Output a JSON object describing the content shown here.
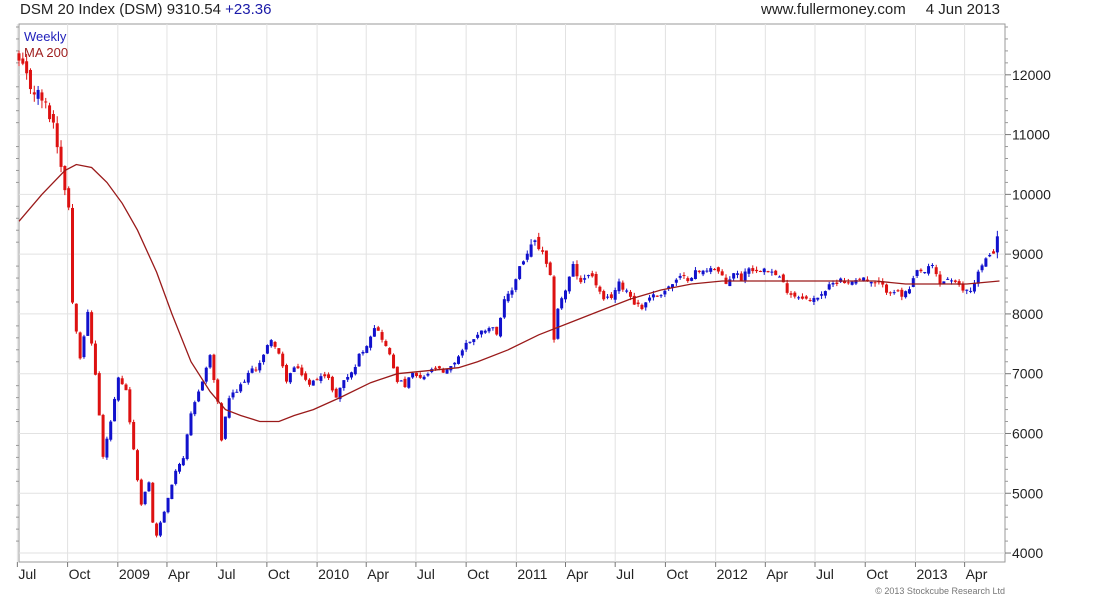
{
  "header": {
    "title": "DSM 20 Index (DSM)",
    "last": "9310.54",
    "change": "+23.36",
    "site": "www.fullermoney.com",
    "date": "4 Jun 2013"
  },
  "legend": {
    "weekly": "Weekly",
    "ma": "MA 200"
  },
  "copyright": "© 2013 Stockcube Research Ltd",
  "colors": {
    "up": "#1111cc",
    "down": "#dd1111",
    "ma": "#9a1a1a",
    "grid": "#e2e2e2"
  },
  "chart_data": {
    "type": "candlestick",
    "frequency": "weekly",
    "ylim": [
      3850,
      12850
    ],
    "yticks": [
      4000,
      5000,
      6000,
      7000,
      8000,
      9000,
      10000,
      11000,
      12000
    ],
    "x_range": [
      "2008-07-04",
      "2013-06-14"
    ],
    "xticks": [
      {
        "label": "Jul",
        "date": "2008-07-01"
      },
      {
        "label": "Oct",
        "date": "2008-10-01"
      },
      {
        "label": "2009",
        "date": "2009-01-01"
      },
      {
        "label": "Apr",
        "date": "2009-04-01"
      },
      {
        "label": "Jul",
        "date": "2009-07-01"
      },
      {
        "label": "Oct",
        "date": "2009-10-01"
      },
      {
        "label": "2010",
        "date": "2010-01-01"
      },
      {
        "label": "Apr",
        "date": "2010-04-01"
      },
      {
        "label": "Jul",
        "date": "2010-07-01"
      },
      {
        "label": "Oct",
        "date": "2010-10-01"
      },
      {
        "label": "2011",
        "date": "2011-01-01"
      },
      {
        "label": "Apr",
        "date": "2011-04-01"
      },
      {
        "label": "Jul",
        "date": "2011-07-01"
      },
      {
        "label": "Oct",
        "date": "2011-10-01"
      },
      {
        "label": "2012",
        "date": "2012-01-01"
      },
      {
        "label": "Apr",
        "date": "2012-04-01"
      },
      {
        "label": "Jul",
        "date": "2012-07-01"
      },
      {
        "label": "Oct",
        "date": "2012-10-01"
      },
      {
        "label": "2013",
        "date": "2013-01-01"
      },
      {
        "label": "Apr",
        "date": "2013-04-01"
      }
    ],
    "close_series": [
      [
        "2008-07-04",
        12200
      ],
      [
        "2008-07-25",
        11800
      ],
      [
        "2008-08-15",
        11600
      ],
      [
        "2008-09-05",
        11200
      ],
      [
        "2008-09-19",
        10500
      ],
      [
        "2008-10-03",
        9800
      ],
      [
        "2008-10-10",
        8200
      ],
      [
        "2008-10-24",
        7300
      ],
      [
        "2008-11-07",
        8000
      ],
      [
        "2008-11-21",
        7000
      ],
      [
        "2008-12-05",
        5600
      ],
      [
        "2008-12-19",
        6200
      ],
      [
        "2009-01-02",
        6900
      ],
      [
        "2009-01-16",
        6700
      ],
      [
        "2009-01-30",
        5700
      ],
      [
        "2009-02-13",
        4800
      ],
      [
        "2009-02-27",
        5200
      ],
      [
        "2009-03-06",
        4500
      ],
      [
        "2009-03-13",
        4300
      ],
      [
        "2009-03-20",
        4500
      ],
      [
        "2009-04-03",
        4900
      ],
      [
        "2009-04-17",
        5400
      ],
      [
        "2009-05-01",
        5600
      ],
      [
        "2009-05-15",
        6300
      ],
      [
        "2009-06-05",
        6900
      ],
      [
        "2009-06-19",
        7300
      ],
      [
        "2009-07-03",
        6500
      ],
      [
        "2009-07-10",
        5900
      ],
      [
        "2009-07-24",
        6600
      ],
      [
        "2009-08-07",
        6700
      ],
      [
        "2009-08-28",
        7000
      ],
      [
        "2009-09-11",
        7100
      ],
      [
        "2009-09-25",
        7300
      ],
      [
        "2009-10-09",
        7600
      ],
      [
        "2009-10-23",
        7300
      ],
      [
        "2009-11-06",
        6900
      ],
      [
        "2009-11-20",
        7100
      ],
      [
        "2009-12-04",
        7000
      ],
      [
        "2009-12-18",
        6800
      ],
      [
        "2010-01-08",
        7000
      ],
      [
        "2010-01-22",
        6900
      ],
      [
        "2010-02-05",
        6600
      ],
      [
        "2010-02-19",
        6900
      ],
      [
        "2010-03-05",
        7000
      ],
      [
        "2010-03-19",
        7300
      ],
      [
        "2010-04-02",
        7500
      ],
      [
        "2010-04-16",
        7800
      ],
      [
        "2010-04-30",
        7600
      ],
      [
        "2010-05-14",
        7300
      ],
      [
        "2010-05-28",
        6900
      ],
      [
        "2010-06-11",
        6800
      ],
      [
        "2010-06-25",
        7000
      ],
      [
        "2010-07-09",
        6900
      ],
      [
        "2010-07-23",
        7000
      ],
      [
        "2010-08-06",
        7100
      ],
      [
        "2010-08-20",
        7000
      ],
      [
        "2010-09-03",
        7100
      ],
      [
        "2010-09-17",
        7300
      ],
      [
        "2010-10-01",
        7500
      ],
      [
        "2010-10-15",
        7600
      ],
      [
        "2010-10-29",
        7700
      ],
      [
        "2010-11-12",
        7800
      ],
      [
        "2010-11-26",
        7700
      ],
      [
        "2010-12-10",
        8200
      ],
      [
        "2010-12-24",
        8400
      ],
      [
        "2011-01-07",
        8800
      ],
      [
        "2011-01-21",
        9000
      ],
      [
        "2011-02-04",
        9200
      ],
      [
        "2011-02-18",
        9000
      ],
      [
        "2011-03-04",
        8600
      ],
      [
        "2011-03-11",
        7600
      ],
      [
        "2011-03-18",
        8100
      ],
      [
        "2011-04-01",
        8400
      ],
      [
        "2011-04-15",
        8800
      ],
      [
        "2011-04-29",
        8500
      ],
      [
        "2011-05-13",
        8700
      ],
      [
        "2011-05-27",
        8500
      ],
      [
        "2011-06-10",
        8200
      ],
      [
        "2011-06-24",
        8300
      ],
      [
        "2011-07-08",
        8500
      ],
      [
        "2011-07-22",
        8400
      ],
      [
        "2011-08-05",
        8200
      ],
      [
        "2011-08-19",
        8100
      ],
      [
        "2011-09-02",
        8300
      ],
      [
        "2011-09-16",
        8300
      ],
      [
        "2011-09-30",
        8400
      ],
      [
        "2011-10-14",
        8500
      ],
      [
        "2011-10-28",
        8600
      ],
      [
        "2011-11-11",
        8600
      ],
      [
        "2011-11-25",
        8700
      ],
      [
        "2011-12-09",
        8700
      ],
      [
        "2011-12-23",
        8800
      ],
      [
        "2012-01-06",
        8700
      ],
      [
        "2012-01-20",
        8500
      ],
      [
        "2012-02-03",
        8700
      ],
      [
        "2012-02-17",
        8600
      ],
      [
        "2012-03-02",
        8800
      ],
      [
        "2012-03-16",
        8700
      ],
      [
        "2012-03-30",
        8800
      ],
      [
        "2012-04-13",
        8700
      ],
      [
        "2012-04-27",
        8600
      ],
      [
        "2012-05-11",
        8400
      ],
      [
        "2012-05-25",
        8300
      ],
      [
        "2012-06-08",
        8300
      ],
      [
        "2012-06-22",
        8200
      ],
      [
        "2012-07-06",
        8300
      ],
      [
        "2012-07-20",
        8400
      ],
      [
        "2012-08-03",
        8500
      ],
      [
        "2012-08-17",
        8600
      ],
      [
        "2012-08-31",
        8500
      ],
      [
        "2012-09-14",
        8600
      ],
      [
        "2012-09-28",
        8600
      ],
      [
        "2012-10-12",
        8500
      ],
      [
        "2012-10-26",
        8500
      ],
      [
        "2012-11-09",
        8400
      ],
      [
        "2012-11-23",
        8400
      ],
      [
        "2012-12-07",
        8300
      ],
      [
        "2012-12-21",
        8400
      ],
      [
        "2013-01-04",
        8700
      ],
      [
        "2013-01-18",
        8700
      ],
      [
        "2013-02-01",
        8800
      ],
      [
        "2013-02-15",
        8500
      ],
      [
        "2013-03-01",
        8600
      ],
      [
        "2013-03-15",
        8500
      ],
      [
        "2013-03-29",
        8400
      ],
      [
        "2013-04-12",
        8400
      ],
      [
        "2013-04-26",
        8700
      ],
      [
        "2013-05-10",
        8900
      ],
      [
        "2013-05-24",
        9100
      ],
      [
        "2013-06-04",
        9310.54
      ]
    ],
    "ma200": [
      [
        "2008-07-04",
        9550
      ],
      [
        "2008-08-15",
        10000
      ],
      [
        "2008-09-26",
        10400
      ],
      [
        "2008-10-17",
        10500
      ],
      [
        "2008-11-14",
        10450
      ],
      [
        "2008-12-12",
        10200
      ],
      [
        "2009-01-09",
        9850
      ],
      [
        "2009-02-06",
        9400
      ],
      [
        "2009-03-13",
        8700
      ],
      [
        "2009-04-10",
        8000
      ],
      [
        "2009-05-15",
        7200
      ],
      [
        "2009-06-19",
        6700
      ],
      [
        "2009-07-17",
        6400
      ],
      [
        "2009-08-14",
        6300
      ],
      [
        "2009-09-18",
        6200
      ],
      [
        "2009-10-23",
        6200
      ],
      [
        "2009-11-20",
        6300
      ],
      [
        "2009-12-25",
        6400
      ],
      [
        "2010-02-12",
        6600
      ],
      [
        "2010-04-09",
        6850
      ],
      [
        "2010-05-28",
        7000
      ],
      [
        "2010-07-23",
        7050
      ],
      [
        "2010-09-17",
        7100
      ],
      [
        "2010-10-22",
        7200
      ],
      [
        "2010-12-17",
        7400
      ],
      [
        "2011-02-11",
        7650
      ],
      [
        "2011-04-08",
        7850
      ],
      [
        "2011-06-03",
        8050
      ],
      [
        "2011-07-29",
        8250
      ],
      [
        "2011-09-23",
        8400
      ],
      [
        "2011-11-18",
        8500
      ],
      [
        "2012-01-13",
        8550
      ],
      [
        "2012-03-09",
        8550
      ],
      [
        "2012-05-04",
        8550
      ],
      [
        "2012-06-29",
        8550
      ],
      [
        "2012-08-24",
        8550
      ],
      [
        "2012-10-19",
        8550
      ],
      [
        "2012-12-14",
        8500
      ],
      [
        "2013-02-08",
        8500
      ],
      [
        "2013-04-05",
        8500
      ],
      [
        "2013-06-04",
        8550
      ]
    ]
  }
}
